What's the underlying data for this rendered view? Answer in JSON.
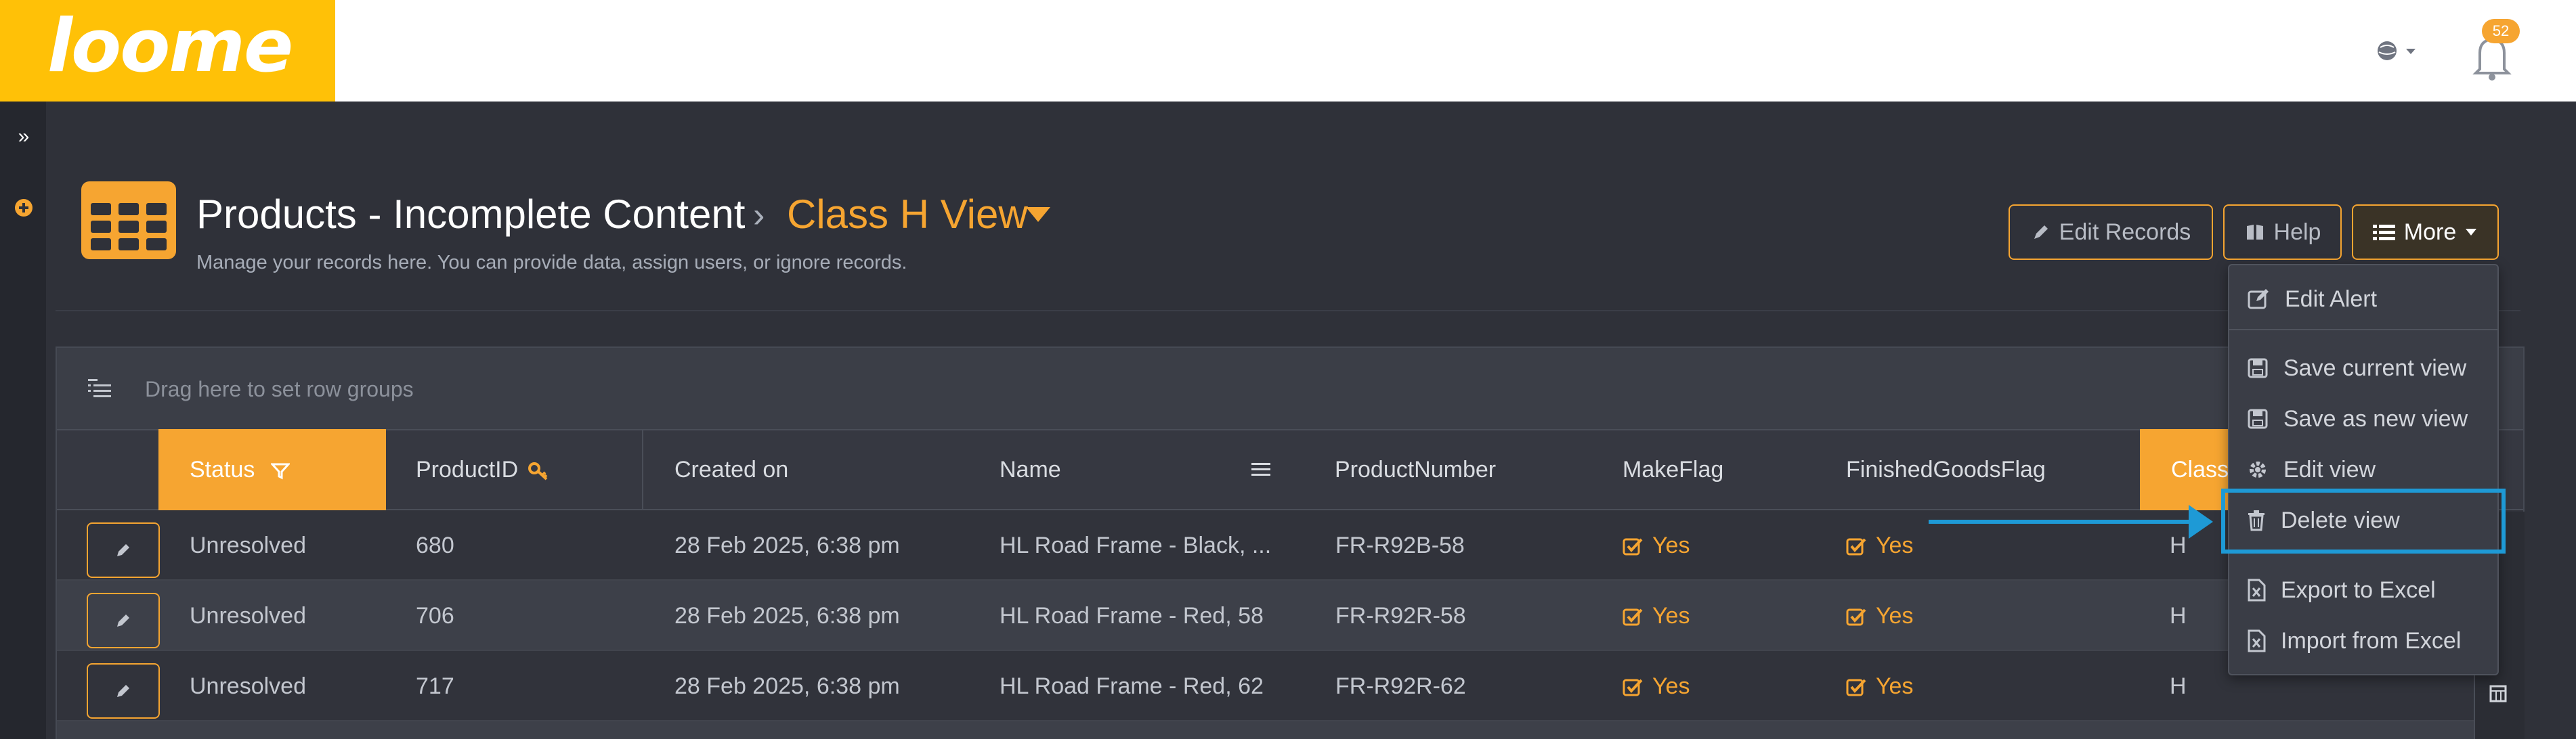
{
  "app": {
    "logo_text": "loome",
    "notification_count": "52",
    "icons": {
      "globe": "globe-icon",
      "bell": "bell-icon",
      "expand": "double-chevron-right-icon",
      "add": "plus-circle-icon"
    }
  },
  "header": {
    "title": "Products - Incomplete Content",
    "breadcrumb_separator": "›",
    "view_name": "Class H View",
    "subtitle": "Manage your records here. You can provide data, assign users, or ignore records.",
    "buttons": {
      "edit_records": "Edit Records",
      "help": "Help",
      "more": "More"
    }
  },
  "grid": {
    "group_placeholder": "Drag here to set row groups",
    "columns": [
      "Status",
      "ProductID",
      "Created on",
      "Name",
      "ProductNumber",
      "MakeFlag",
      "FinishedGoodsFlag",
      "Class"
    ],
    "rows": [
      {
        "status": "Unresolved",
        "product_id": "680",
        "created_on": "28 Feb 2025, 6:38 pm",
        "name": "HL Road Frame - Black, ...",
        "product_number": "FR-R92B-58",
        "make_flag": "Yes",
        "finished_goods_flag": "Yes",
        "class": "H"
      },
      {
        "status": "Unresolved",
        "product_id": "706",
        "created_on": "28 Feb 2025, 6:38 pm",
        "name": "HL Road Frame - Red, 58",
        "product_number": "FR-R92R-58",
        "make_flag": "Yes",
        "finished_goods_flag": "Yes",
        "class": "H"
      },
      {
        "status": "Unresolved",
        "product_id": "717",
        "created_on": "28 Feb 2025, 6:38 pm",
        "name": "HL Road Frame - Red, 62",
        "product_number": "FR-R92R-62",
        "make_flag": "Yes",
        "finished_goods_flag": "Yes",
        "class": "H"
      }
    ]
  },
  "more_menu": {
    "items": [
      {
        "label": "Edit Alert",
        "icon": "edit-alert-icon"
      },
      {
        "label": "Save current view",
        "icon": "save-icon"
      },
      {
        "label": "Save as new view",
        "icon": "save-icon"
      },
      {
        "label": "Edit view",
        "icon": "gear-icon"
      },
      {
        "label": "Delete view",
        "icon": "trash-icon"
      },
      {
        "label": "Export to Excel",
        "icon": "excel-icon"
      },
      {
        "label": "Import from Excel",
        "icon": "excel-icon"
      }
    ]
  },
  "colors": {
    "accent": "#f6a531",
    "logo_bg": "#ffc107",
    "highlight": "#1e9ad6",
    "background": "#2f3139"
  }
}
